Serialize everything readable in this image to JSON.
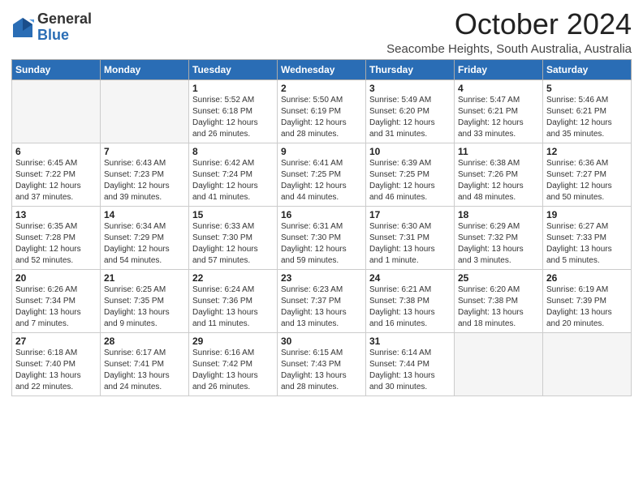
{
  "logo": {
    "general": "General",
    "blue": "Blue"
  },
  "title": "October 2024",
  "location": "Seacombe Heights, South Australia, Australia",
  "days_of_week": [
    "Sunday",
    "Monday",
    "Tuesday",
    "Wednesday",
    "Thursday",
    "Friday",
    "Saturday"
  ],
  "weeks": [
    [
      {
        "day": "",
        "empty": true
      },
      {
        "day": "",
        "empty": true
      },
      {
        "day": "1",
        "sunrise": "Sunrise: 5:52 AM",
        "sunset": "Sunset: 6:18 PM",
        "daylight": "Daylight: 12 hours and 26 minutes."
      },
      {
        "day": "2",
        "sunrise": "Sunrise: 5:50 AM",
        "sunset": "Sunset: 6:19 PM",
        "daylight": "Daylight: 12 hours and 28 minutes."
      },
      {
        "day": "3",
        "sunrise": "Sunrise: 5:49 AM",
        "sunset": "Sunset: 6:20 PM",
        "daylight": "Daylight: 12 hours and 31 minutes."
      },
      {
        "day": "4",
        "sunrise": "Sunrise: 5:47 AM",
        "sunset": "Sunset: 6:21 PM",
        "daylight": "Daylight: 12 hours and 33 minutes."
      },
      {
        "day": "5",
        "sunrise": "Sunrise: 5:46 AM",
        "sunset": "Sunset: 6:21 PM",
        "daylight": "Daylight: 12 hours and 35 minutes."
      }
    ],
    [
      {
        "day": "6",
        "sunrise": "Sunrise: 6:45 AM",
        "sunset": "Sunset: 7:22 PM",
        "daylight": "Daylight: 12 hours and 37 minutes."
      },
      {
        "day": "7",
        "sunrise": "Sunrise: 6:43 AM",
        "sunset": "Sunset: 7:23 PM",
        "daylight": "Daylight: 12 hours and 39 minutes."
      },
      {
        "day": "8",
        "sunrise": "Sunrise: 6:42 AM",
        "sunset": "Sunset: 7:24 PM",
        "daylight": "Daylight: 12 hours and 41 minutes."
      },
      {
        "day": "9",
        "sunrise": "Sunrise: 6:41 AM",
        "sunset": "Sunset: 7:25 PM",
        "daylight": "Daylight: 12 hours and 44 minutes."
      },
      {
        "day": "10",
        "sunrise": "Sunrise: 6:39 AM",
        "sunset": "Sunset: 7:25 PM",
        "daylight": "Daylight: 12 hours and 46 minutes."
      },
      {
        "day": "11",
        "sunrise": "Sunrise: 6:38 AM",
        "sunset": "Sunset: 7:26 PM",
        "daylight": "Daylight: 12 hours and 48 minutes."
      },
      {
        "day": "12",
        "sunrise": "Sunrise: 6:36 AM",
        "sunset": "Sunset: 7:27 PM",
        "daylight": "Daylight: 12 hours and 50 minutes."
      }
    ],
    [
      {
        "day": "13",
        "sunrise": "Sunrise: 6:35 AM",
        "sunset": "Sunset: 7:28 PM",
        "daylight": "Daylight: 12 hours and 52 minutes."
      },
      {
        "day": "14",
        "sunrise": "Sunrise: 6:34 AM",
        "sunset": "Sunset: 7:29 PM",
        "daylight": "Daylight: 12 hours and 54 minutes."
      },
      {
        "day": "15",
        "sunrise": "Sunrise: 6:33 AM",
        "sunset": "Sunset: 7:30 PM",
        "daylight": "Daylight: 12 hours and 57 minutes."
      },
      {
        "day": "16",
        "sunrise": "Sunrise: 6:31 AM",
        "sunset": "Sunset: 7:30 PM",
        "daylight": "Daylight: 12 hours and 59 minutes."
      },
      {
        "day": "17",
        "sunrise": "Sunrise: 6:30 AM",
        "sunset": "Sunset: 7:31 PM",
        "daylight": "Daylight: 13 hours and 1 minute."
      },
      {
        "day": "18",
        "sunrise": "Sunrise: 6:29 AM",
        "sunset": "Sunset: 7:32 PM",
        "daylight": "Daylight: 13 hours and 3 minutes."
      },
      {
        "day": "19",
        "sunrise": "Sunrise: 6:27 AM",
        "sunset": "Sunset: 7:33 PM",
        "daylight": "Daylight: 13 hours and 5 minutes."
      }
    ],
    [
      {
        "day": "20",
        "sunrise": "Sunrise: 6:26 AM",
        "sunset": "Sunset: 7:34 PM",
        "daylight": "Daylight: 13 hours and 7 minutes."
      },
      {
        "day": "21",
        "sunrise": "Sunrise: 6:25 AM",
        "sunset": "Sunset: 7:35 PM",
        "daylight": "Daylight: 13 hours and 9 minutes."
      },
      {
        "day": "22",
        "sunrise": "Sunrise: 6:24 AM",
        "sunset": "Sunset: 7:36 PM",
        "daylight": "Daylight: 13 hours and 11 minutes."
      },
      {
        "day": "23",
        "sunrise": "Sunrise: 6:23 AM",
        "sunset": "Sunset: 7:37 PM",
        "daylight": "Daylight: 13 hours and 13 minutes."
      },
      {
        "day": "24",
        "sunrise": "Sunrise: 6:21 AM",
        "sunset": "Sunset: 7:38 PM",
        "daylight": "Daylight: 13 hours and 16 minutes."
      },
      {
        "day": "25",
        "sunrise": "Sunrise: 6:20 AM",
        "sunset": "Sunset: 7:38 PM",
        "daylight": "Daylight: 13 hours and 18 minutes."
      },
      {
        "day": "26",
        "sunrise": "Sunrise: 6:19 AM",
        "sunset": "Sunset: 7:39 PM",
        "daylight": "Daylight: 13 hours and 20 minutes."
      }
    ],
    [
      {
        "day": "27",
        "sunrise": "Sunrise: 6:18 AM",
        "sunset": "Sunset: 7:40 PM",
        "daylight": "Daylight: 13 hours and 22 minutes."
      },
      {
        "day": "28",
        "sunrise": "Sunrise: 6:17 AM",
        "sunset": "Sunset: 7:41 PM",
        "daylight": "Daylight: 13 hours and 24 minutes."
      },
      {
        "day": "29",
        "sunrise": "Sunrise: 6:16 AM",
        "sunset": "Sunset: 7:42 PM",
        "daylight": "Daylight: 13 hours and 26 minutes."
      },
      {
        "day": "30",
        "sunrise": "Sunrise: 6:15 AM",
        "sunset": "Sunset: 7:43 PM",
        "daylight": "Daylight: 13 hours and 28 minutes."
      },
      {
        "day": "31",
        "sunrise": "Sunrise: 6:14 AM",
        "sunset": "Sunset: 7:44 PM",
        "daylight": "Daylight: 13 hours and 30 minutes."
      },
      {
        "day": "",
        "empty": true
      },
      {
        "day": "",
        "empty": true
      }
    ]
  ]
}
